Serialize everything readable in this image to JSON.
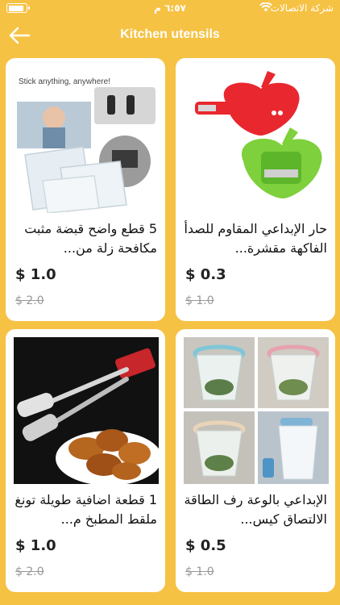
{
  "status_bar": {
    "time": "٦:٥٧ م",
    "carrier": "شركة الاتصالات"
  },
  "nav": {
    "title": "Kitchen utensils",
    "back_icon": "arrow-left-icon"
  },
  "colors": {
    "background": "#F6C244",
    "card": "#FFFFFF",
    "price": "#222222",
    "old_price": "#999999"
  },
  "products": [
    {
      "title": "5 قطع واضح قبضة مثبت مكافحة زلة من...",
      "price": "$ 1.0",
      "old_price": "$ 2.0",
      "image_text": "Stick anything, anywhere!"
    },
    {
      "title": "حار الإبداعي المقاوم للصدأ الفاكهة مقشرة...",
      "price": "$ 0.3",
      "old_price": "$ 1.0"
    },
    {
      "title": "1 قطعة اضافية طويلة تونغ ملقط المطبخ م...",
      "price": "$ 1.0",
      "old_price": "$ 2.0"
    },
    {
      "title": "الإبداعي بالوعة رف الطاقة الالتصاق كيس...",
      "price": "$ 0.5",
      "old_price": "$ 1.0"
    }
  ]
}
